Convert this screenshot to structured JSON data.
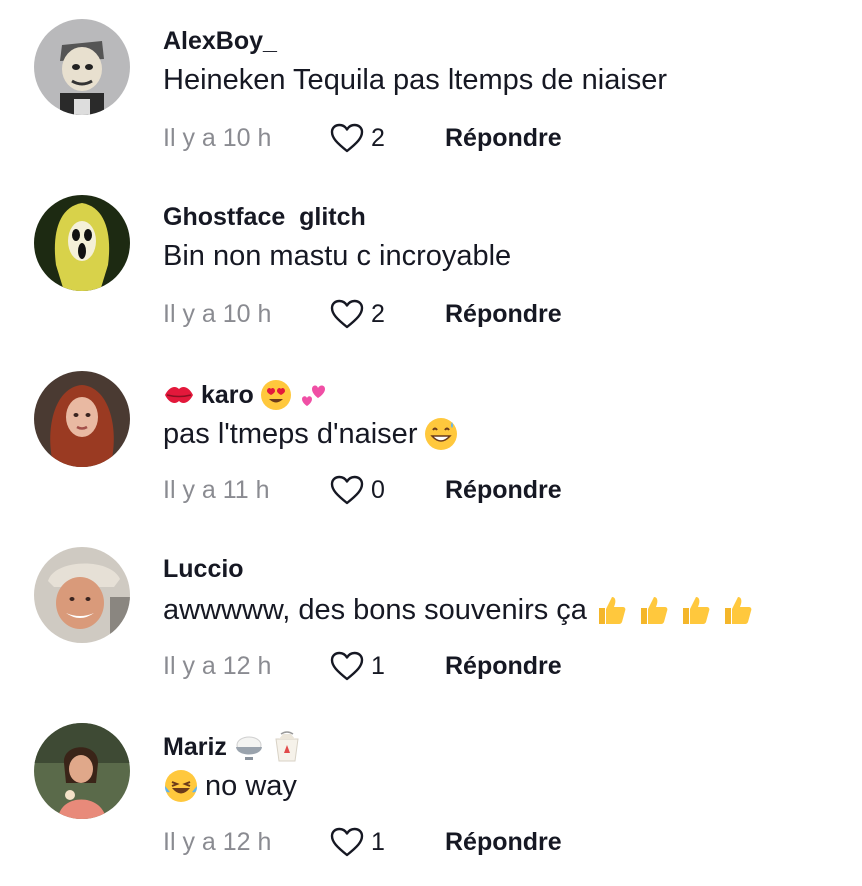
{
  "comments": [
    {
      "username": "AlexBoy_",
      "text": "Heineken Tequila pas ltemps de niaiser",
      "time": "Il y a 10 h",
      "likes": "2",
      "reply_label": "Répondre"
    },
    {
      "username": "Ghostface  glitch",
      "text": "Bin non mastu c incroyable",
      "time": "Il y a 10 h",
      "likes": "2",
      "reply_label": "Répondre"
    },
    {
      "username": "karo",
      "text": "pas l'tmeps d'naiser",
      "time": "Il y a 11 h",
      "likes": "0",
      "reply_label": "Répondre"
    },
    {
      "username": "Luccio",
      "text": "awwwww, des bons souvenirs ça",
      "time": "Il y a 12 h",
      "likes": "1",
      "reply_label": "Répondre"
    },
    {
      "username": "Mariz",
      "text": "no way",
      "time": "Il y a 12 h",
      "likes": "1",
      "reply_label": "Répondre"
    }
  ],
  "icons": {
    "like": "heart-outline-icon",
    "karo_prefix": "kiss-mark-emoji",
    "karo_suffix": [
      "heart-eyes-emoji",
      "revolving-hearts-emoji"
    ],
    "karo_text_suffix": "grinning-sweat-emoji",
    "luccio_text_suffix": [
      "thumbs-up-emoji",
      "thumbs-up-emoji",
      "thumbs-up-emoji",
      "thumbs-up-emoji"
    ],
    "mariz_suffix": [
      "rice-bowl-emoji",
      "takeout-box-emoji"
    ],
    "mariz_text_prefix": "laughing-tears-emoji"
  },
  "colors": {
    "text": "#161823",
    "secondary": "#8a8b91",
    "background": "#ffffff"
  }
}
